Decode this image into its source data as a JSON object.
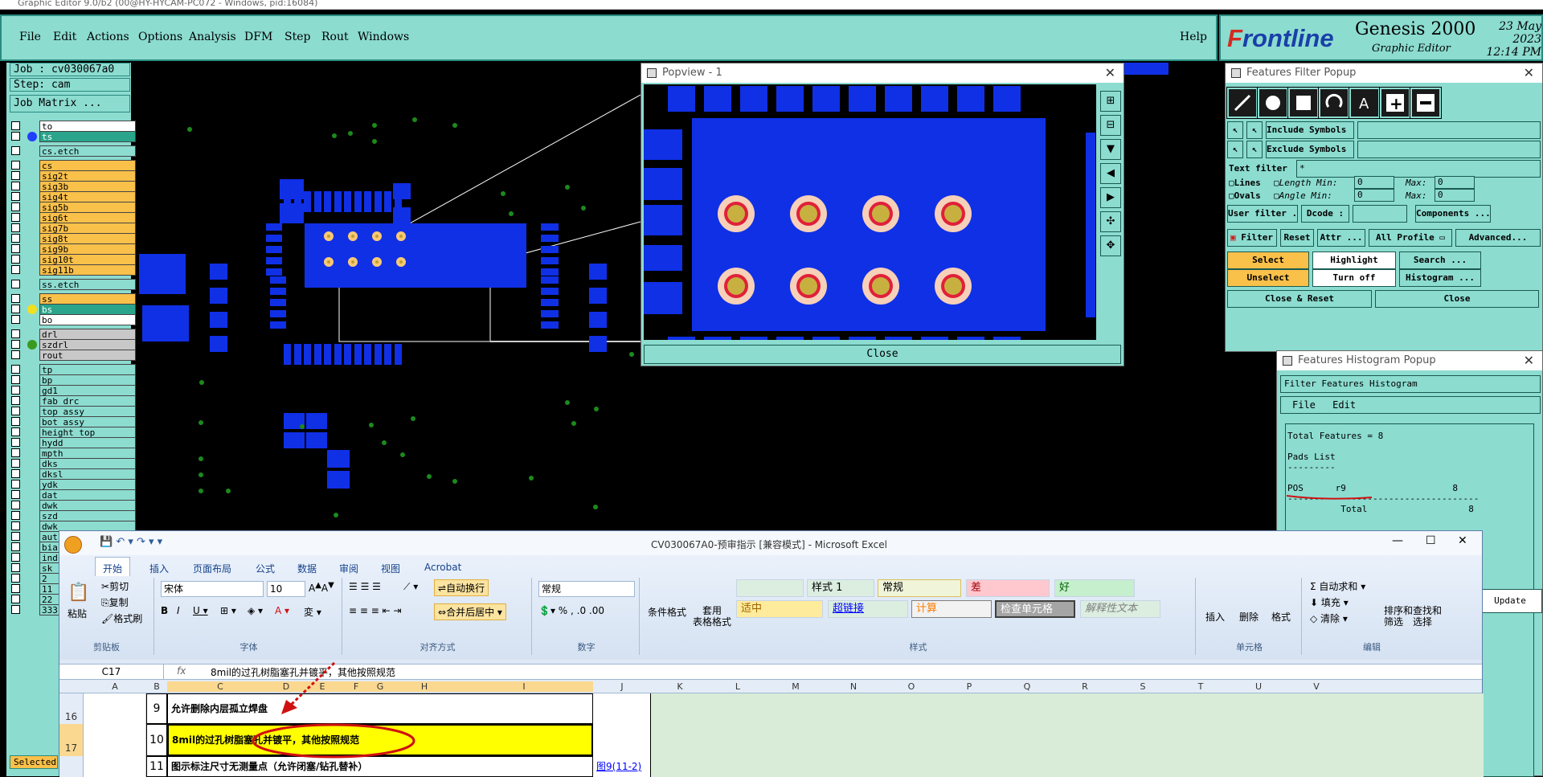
{
  "window_title": "Graphic Editor 9.0/b2 (00@HY-HYCAM-PC072 - Windows, pid:16084)",
  "menu": [
    "File",
    "Edit",
    "Actions",
    "Options",
    "Analysis",
    "DFM",
    "Step",
    "Rout",
    "Windows"
  ],
  "help": "Help",
  "logo": {
    "brand_pre": "F",
    "brand": "rontline",
    "product": "Genesis 2000",
    "subtitle": "Graphic Editor",
    "date": "23 May 2023",
    "time": "12:14 PM"
  },
  "job": {
    "job_label": "Job : cv030067a0",
    "step_label": "Step: cam",
    "matrix_button": "Job Matrix ..."
  },
  "layers": [
    {
      "name": "to",
      "style": "w"
    },
    {
      "name": "ts",
      "style": "g",
      "dot": "#2040ff"
    },
    {
      "name": "cs.etch",
      "style": "c"
    },
    {
      "name": "cs",
      "style": "o"
    },
    {
      "name": "sig2t",
      "style": "o"
    },
    {
      "name": "sig3b",
      "style": "o"
    },
    {
      "name": "sig4t",
      "style": "o"
    },
    {
      "name": "sig5b",
      "style": "o"
    },
    {
      "name": "sig6t",
      "style": "o"
    },
    {
      "name": "sig7b",
      "style": "o"
    },
    {
      "name": "sig8t",
      "style": "o"
    },
    {
      "name": "sig9b",
      "style": "o"
    },
    {
      "name": "sig10t",
      "style": "o"
    },
    {
      "name": "sig11b",
      "style": "o"
    },
    {
      "name": "ss.etch",
      "style": "c"
    },
    {
      "name": "ss",
      "style": "o"
    },
    {
      "name": "bs",
      "style": "g",
      "dot": "#f0e020"
    },
    {
      "name": "bo",
      "style": "w"
    },
    {
      "name": "drl",
      "style": "gr"
    },
    {
      "name": "szdrl",
      "style": "gr",
      "dot": "#3a9a20"
    },
    {
      "name": "rout",
      "style": "gr"
    },
    {
      "name": "tp",
      "style": "c"
    },
    {
      "name": "bp",
      "style": "c"
    },
    {
      "name": "gd1",
      "style": "c"
    },
    {
      "name": "fab_drc",
      "style": "c"
    },
    {
      "name": "top_assy",
      "style": "c"
    },
    {
      "name": "bot_assy",
      "style": "c"
    },
    {
      "name": "height_top",
      "style": "c"
    },
    {
      "name": "hydd",
      "style": "c"
    },
    {
      "name": "mpth",
      "style": "c"
    },
    {
      "name": "dks",
      "style": "c"
    },
    {
      "name": "dksl",
      "style": "c"
    },
    {
      "name": "ydk",
      "style": "c"
    },
    {
      "name": "dat",
      "style": "c"
    },
    {
      "name": "dwk",
      "style": "c"
    },
    {
      "name": "szd",
      "style": "c"
    },
    {
      "name": "dwk",
      "style": "c"
    },
    {
      "name": "aut",
      "style": "c"
    },
    {
      "name": "bia",
      "style": "c"
    },
    {
      "name": "ind",
      "style": "c"
    },
    {
      "name": "sk_",
      "style": "c"
    },
    {
      "name": "2",
      "style": "c"
    },
    {
      "name": "11",
      "style": "c"
    },
    {
      "name": "22",
      "style": "c"
    },
    {
      "name": "333",
      "style": "c"
    }
  ],
  "status_selected": "Selected",
  "popview": {
    "title": "Popview - 1",
    "close": "Close"
  },
  "filter": {
    "title": "Features Filter Popup",
    "include": "Include Symbols :",
    "exclude": "Exclude Symbols :",
    "text_filter": "Text filter",
    "text_filter_value": "*",
    "lines": "Lines",
    "ovals": "Ovals",
    "length": "Length",
    "angle": "Angle",
    "min": "Min:",
    "max": "Max:",
    "zero": "0",
    "user_filter": "User filter ...",
    "dcode": "Dcode :",
    "components": "Components ...",
    "filter": "Filter",
    "reset": "Reset",
    "attr": "Attr ...",
    "profile": "All Profile",
    "advanced": "Advanced...",
    "select": "Select",
    "highlight": "Highlight",
    "search": "Search ...",
    "unselect": "Unselect",
    "turn_off": "Turn off",
    "histogram": "Histogram ...",
    "close_reset": "Close & Reset",
    "close": "Close"
  },
  "histogram": {
    "title": "Features Histogram Popup",
    "header": "Filter Features Histogram",
    "menu": [
      "File",
      "Edit"
    ],
    "total": "Total Features = 8",
    "pads": "Pads List",
    "sep": "---------",
    "pos": "POS",
    "sym": "r9",
    "count": "8",
    "line": "------------------------------------",
    "total_lbl": "Total",
    "total_cnt": "8",
    "update": "Update"
  },
  "excel": {
    "title": "CV030067A0-预审指示  [兼容模式] - Microsoft Excel",
    "tabs": [
      "开始",
      "插入",
      "页面布局",
      "公式",
      "数据",
      "审阅",
      "视图",
      "Acrobat"
    ],
    "clipboard": {
      "paste": "粘贴",
      "cut": "剪切",
      "copy": "复制",
      "format": "格式刷",
      "label": "剪贴板"
    },
    "font": {
      "name": "宋体",
      "size": "10",
      "label": "字体"
    },
    "align": {
      "wrap": "自动换行",
      "merge": "合并后居中",
      "label": "对齐方式"
    },
    "number": {
      "fmt": "常规",
      "label": "数字"
    },
    "styles": {
      "cond": "条件格式",
      "table": "套用\n表格格式",
      "normal": "常规",
      "bad": "差",
      "good": "好",
      "style1": "样式 1",
      "neutral": "适中",
      "hyperlink": "超链接",
      "calc": "计算",
      "check": "检查单元格",
      "explain": "解释性文本",
      "label": "样式"
    },
    "cells": {
      "insert": "插入",
      "delete": "删除",
      "format": "格式",
      "label": "单元格"
    },
    "edit": {
      "autosum": "自动求和",
      "fill": "填充",
      "clear": "清除",
      "sort": "排序和\n筛选",
      "find": "查找和\n选择",
      "label": "编辑"
    },
    "namebox": "C17",
    "fx": "fx",
    "formula": "8mil的过孔树脂塞孔并镀平，其他按照规范",
    "columns": [
      "A",
      "B",
      "C",
      "D",
      "E",
      "F",
      "G",
      "H",
      "I",
      "J",
      "K",
      "L",
      "M",
      "N",
      "O",
      "P",
      "Q",
      "R",
      "S",
      "T",
      "U",
      "V"
    ],
    "rows": [
      {
        "hdr": "16",
        "num": "9",
        "text": "允许删除内层孤立焊盘"
      },
      {
        "hdr": "17",
        "num": "10",
        "text": "8mil的过孔树脂塞孔并镀平，其他按照规范"
      },
      {
        "hdr": "",
        "num": "11",
        "text": "图示标注尺寸无测量点（允许闭塞/钻孔替补）",
        "link": "图9(11-2)"
      }
    ]
  }
}
